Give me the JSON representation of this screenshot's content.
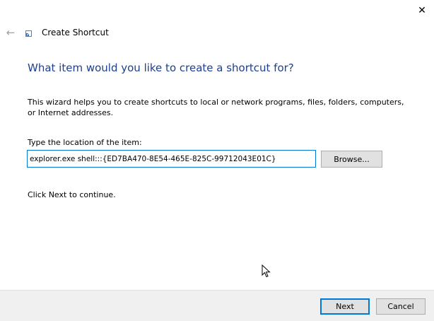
{
  "window": {
    "title": "Create Shortcut",
    "close_glyph": "✕",
    "back_glyph": "←"
  },
  "page": {
    "heading": "What item would you like to create a shortcut for?",
    "description": "This wizard helps you to create shortcuts to local or network programs, files, folders, computers, or Internet addresses.",
    "location_label": "Type the location of the item:",
    "location_value": "explorer.exe shell:::{ED7BA470-8E54-465E-825C-99712043E01C}",
    "browse_label": "Browse...",
    "continue_text": "Click Next to continue."
  },
  "footer": {
    "next_label": "Next",
    "cancel_label": "Cancel"
  },
  "colors": {
    "heading": "#1c3f94",
    "accent": "#0078d7",
    "footer_bg": "#f0f0f0",
    "button_bg": "#e1e1e1"
  },
  "icons": {
    "close": "close-icon",
    "back": "back-arrow-icon",
    "title": "shortcut-icon",
    "cursor": "mouse-pointer-icon"
  }
}
